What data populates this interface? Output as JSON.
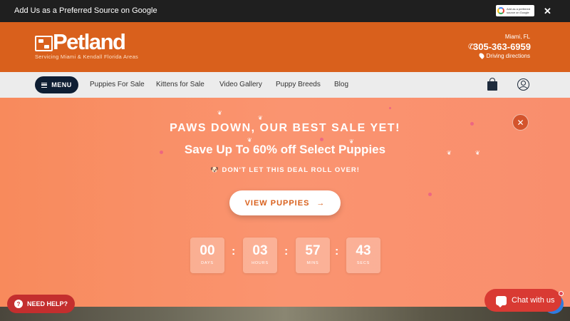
{
  "google_bar": {
    "text": "Add Us as a Preferred Source on Google",
    "badge_text": "Add as a preferred source on Google",
    "close": "✕"
  },
  "header": {
    "logo": "Petland",
    "tagline": "Servicing Miami & Kendall Florida Areas",
    "location": "Miami, FL",
    "phone": "305-363-6959",
    "directions": "Driving directions"
  },
  "nav": {
    "menu_label": "MENU",
    "links": [
      "Puppies For Sale",
      "Kittens for Sale",
      "Video Gallery",
      "Puppy Breeds",
      "Blog"
    ]
  },
  "hero": {
    "headline": "PAWS DOWN, OUR BEST SALE YET!",
    "subheadline": "Save Up To 60% off Select Puppies",
    "tagline": "🐶 DON'T LET THIS DEAL ROLL OVER!",
    "cta": "VIEW PUPPIES",
    "cta_arrow": "→",
    "close": "✕",
    "countdown": [
      {
        "value": "00",
        "label": "DAYS"
      },
      {
        "value": "03",
        "label": "HOURS"
      },
      {
        "value": "57",
        "label": "MINS"
      },
      {
        "value": "43",
        "label": "SECS"
      }
    ]
  },
  "help": {
    "label": "NEED HELP?",
    "icon": "?"
  },
  "chat": {
    "label": "Chat with us"
  },
  "colors": {
    "brand_orange": "#d9601c",
    "nav_dark": "#0e1e33",
    "hero": "#fa9470",
    "help_red": "#c42e2e"
  }
}
